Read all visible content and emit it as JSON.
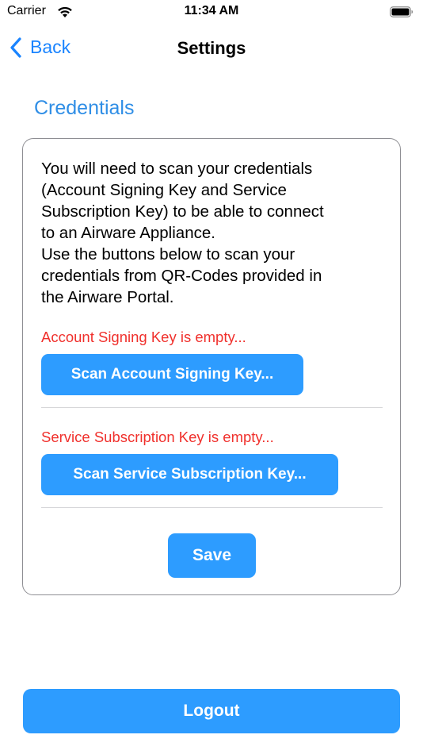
{
  "status_bar": {
    "carrier": "Carrier",
    "time": "11:34 AM",
    "wifi_icon": "wifi-icon",
    "battery_icon": "battery-full-icon"
  },
  "nav": {
    "back_label": "Back",
    "back_icon": "chevron-left-icon",
    "title": "Settings"
  },
  "section": {
    "title": "Credentials"
  },
  "card": {
    "intro_lines": [
      "You will need to scan your credentials",
      "(Account Signing Key and Service",
      "Subscription Key) to be able to connect",
      "to an Airware Appliance.",
      "Use the buttons below to scan your",
      "credentials from QR-Codes provided in",
      "the Airware Portal."
    ],
    "account_key": {
      "status": "Account Signing Key is empty...",
      "button_label": "Scan Account Signing Key..."
    },
    "service_key": {
      "status": "Service Subscription Key is empty...",
      "button_label": "Scan Service Subscription Key..."
    },
    "save_label": "Save"
  },
  "logout_label": "Logout",
  "colors": {
    "accent": "#2d9cff",
    "link": "#1a84ff",
    "section_title": "#2f8ee6",
    "warning": "#f0302c",
    "card_border": "#8e8e93",
    "divider": "#d6d6d9"
  }
}
